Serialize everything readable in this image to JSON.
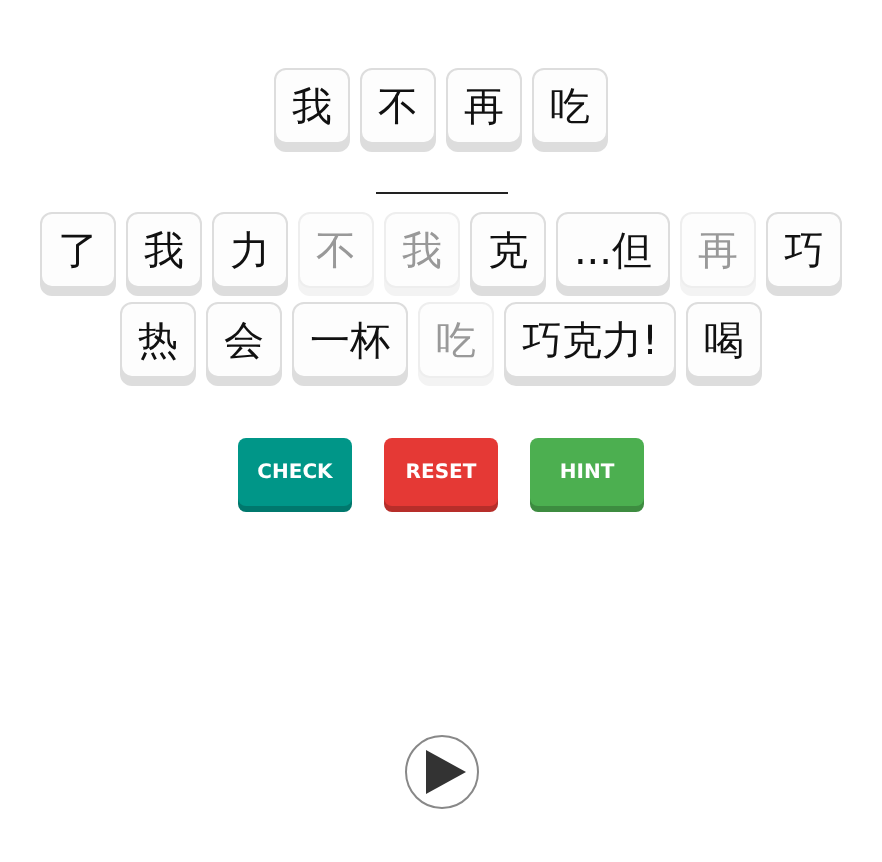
{
  "answer": [
    {
      "text": "我"
    },
    {
      "text": "不"
    },
    {
      "text": "再"
    },
    {
      "text": "吃"
    }
  ],
  "bank": [
    {
      "text": "了",
      "used": false
    },
    {
      "text": "我",
      "used": false
    },
    {
      "text": "力",
      "used": false
    },
    {
      "text": "不",
      "used": true
    },
    {
      "text": "我",
      "used": true
    },
    {
      "text": "克",
      "used": false
    },
    {
      "text": "...但",
      "used": false
    },
    {
      "text": "再",
      "used": true
    },
    {
      "text": "巧",
      "used": false
    },
    {
      "text": "热",
      "used": false
    },
    {
      "text": "会",
      "used": false
    },
    {
      "text": "一杯",
      "used": false
    },
    {
      "text": "吃",
      "used": true
    },
    {
      "text": "巧克力!",
      "used": false
    },
    {
      "text": "喝",
      "used": false
    }
  ],
  "buttons": [
    {
      "label": "CHECK",
      "color": "#009688"
    },
    {
      "label": "RESET",
      "color": "#e53935"
    },
    {
      "label": "HINT",
      "color": "#4caf50"
    }
  ]
}
